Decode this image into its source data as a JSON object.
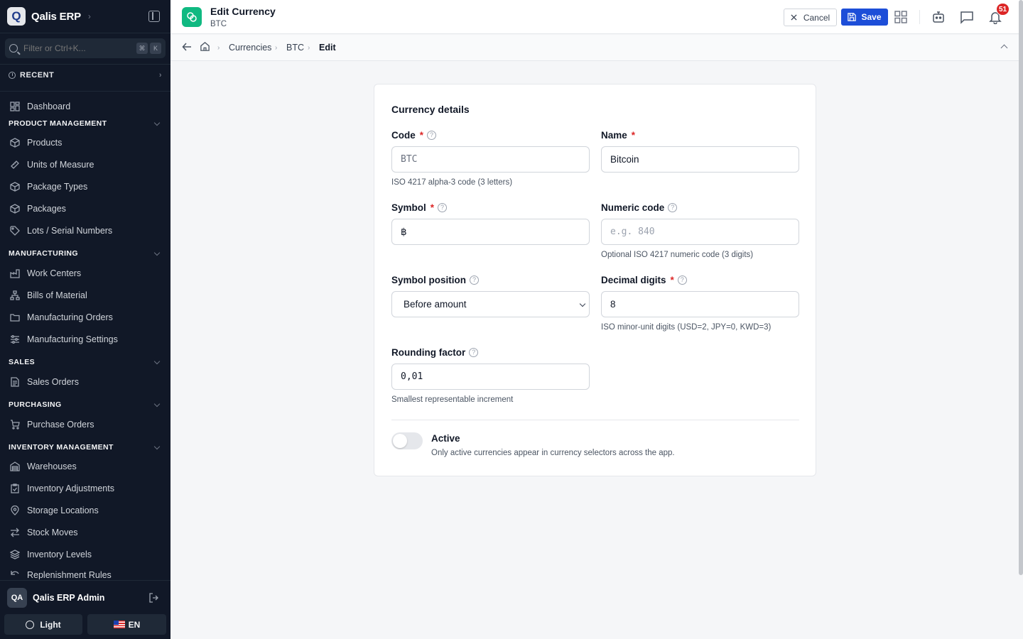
{
  "app": {
    "name": "Qalis ERP",
    "logo_letter": "Q"
  },
  "sidebar": {
    "filter_placeholder": "Filter or Ctrl+K...",
    "filter_kbd": [
      "⌘",
      "K"
    ],
    "recent_label": "RECENT",
    "dashboard": "Dashboard",
    "sections": {
      "product_management": {
        "label": "PRODUCT MANAGEMENT",
        "items": [
          "Products",
          "Units of Measure",
          "Package Types",
          "Packages",
          "Lots / Serial Numbers"
        ]
      },
      "manufacturing": {
        "label": "MANUFACTURING",
        "items": [
          "Work Centers",
          "Bills of Material",
          "Manufacturing Orders",
          "Manufacturing Settings"
        ]
      },
      "sales": {
        "label": "SALES",
        "items": [
          "Sales Orders"
        ]
      },
      "purchasing": {
        "label": "PURCHASING",
        "items": [
          "Purchase Orders"
        ]
      },
      "inventory_management": {
        "label": "INVENTORY MANAGEMENT",
        "items": [
          "Warehouses",
          "Inventory Adjustments",
          "Storage Locations",
          "Stock Moves",
          "Inventory Levels",
          "Replenishment Rules"
        ]
      }
    },
    "user": {
      "initials": "QA",
      "name": "Qalis ERP Admin"
    },
    "theme_label": "Light",
    "lang_label": "EN"
  },
  "header": {
    "title": "Edit Currency",
    "subtitle": "BTC",
    "cancel_label": "Cancel",
    "save_label": "Save",
    "notification_count": "51"
  },
  "breadcrumb": [
    "Currencies",
    "BTC",
    "Edit"
  ],
  "form": {
    "section_title": "Currency details",
    "code": {
      "label": "Code",
      "required": "*",
      "value": "BTC",
      "hint": "ISO 4217 alpha-3 code (3 letters)"
    },
    "name": {
      "label": "Name",
      "required": "*",
      "value": "Bitcoin"
    },
    "symbol": {
      "label": "Symbol",
      "required": "*",
      "value": "฿"
    },
    "numeric_code": {
      "label": "Numeric code",
      "value": "",
      "placeholder": "e.g. 840",
      "hint": "Optional ISO 4217 numeric code (3 digits)"
    },
    "symbol_position": {
      "label": "Symbol position",
      "value": "Before amount"
    },
    "decimal_digits": {
      "label": "Decimal digits",
      "required": "*",
      "value": "8",
      "hint": "ISO minor-unit digits (USD=2, JPY=0, KWD=3)"
    },
    "rounding_factor": {
      "label": "Rounding factor",
      "value": "0,01",
      "hint": "Smallest representable increment"
    },
    "active": {
      "label": "Active",
      "on": false,
      "description": "Only active currencies appear in currency selectors across the app."
    }
  },
  "colors": {
    "sidebar_bg": "#111827",
    "primary": "#1d4ed8",
    "page_icon": "#10b981",
    "required": "#dc2626"
  }
}
